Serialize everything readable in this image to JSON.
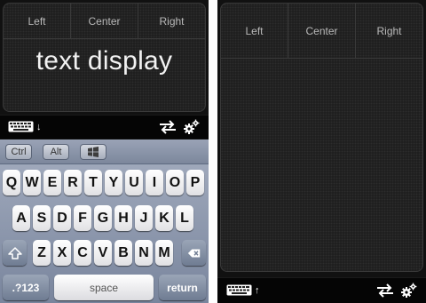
{
  "left_screen": {
    "mouse_buttons": [
      "Left",
      "Center",
      "Right"
    ],
    "text_display": "text display",
    "toolbar": {
      "keyboard_icon": "keyboard-icon",
      "toggle_arrow": "↓",
      "swap_icon": "swap-arrows-icon",
      "settings_icon": "gear-icon"
    },
    "keyboard": {
      "modifiers": [
        "Ctrl",
        "Alt"
      ],
      "windows_key_icon": "windows-logo-icon",
      "row1": [
        "Q",
        "W",
        "E",
        "R",
        "T",
        "Y",
        "U",
        "I",
        "O",
        "P"
      ],
      "row2": [
        "A",
        "S",
        "D",
        "F",
        "G",
        "H",
        "J",
        "K",
        "L"
      ],
      "row3": [
        "Z",
        "X",
        "C",
        "V",
        "B",
        "N",
        "M"
      ],
      "shift_icon": "shift-icon",
      "backspace_icon": "backspace-icon",
      "numbers_label": ".?123",
      "space_label": "space",
      "return_label": "return"
    }
  },
  "right_screen": {
    "mouse_buttons": [
      "Left",
      "Center",
      "Right"
    ],
    "toolbar": {
      "keyboard_icon": "keyboard-icon",
      "toggle_arrow": "↑",
      "swap_icon": "swap-arrows-icon",
      "settings_icon": "gear-icon"
    }
  },
  "colors": {
    "pad_background": "#1c1c1c",
    "toolbar_background": "#050505",
    "keyboard_background": "#8f9ab0",
    "key_face": "#f4f4f6",
    "dark_key": "#7e8aa0"
  }
}
